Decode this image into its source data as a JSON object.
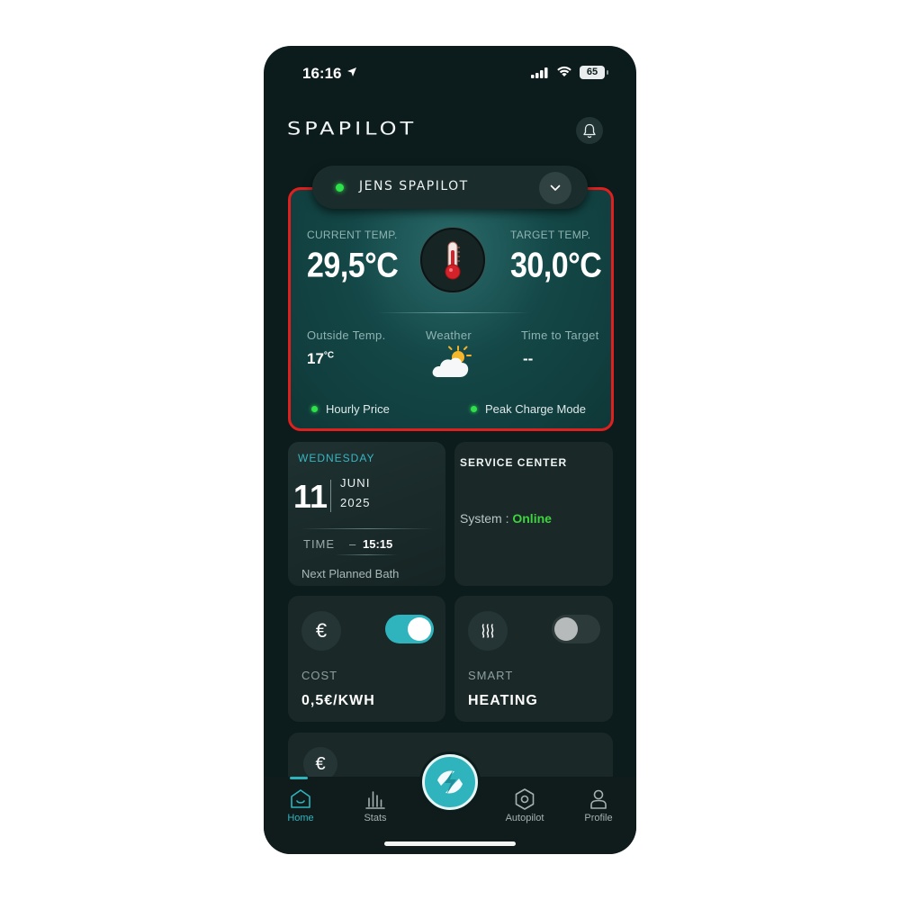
{
  "status_bar": {
    "time": "16:16",
    "battery": "65"
  },
  "header": {
    "brand": "SPAPILOT"
  },
  "device": {
    "name": "JENS SPAPILOT"
  },
  "temperature": {
    "current_label": "CURRENT TEMP.",
    "current_value": "29,5°C",
    "target_label": "TARGET TEMP.",
    "target_value": "30,0°C",
    "outside_label": "Outside Temp.",
    "outside_value": "17",
    "outside_unit": "°C",
    "weather_label": "Weather",
    "time_label": "Time to Target",
    "time_value": "--",
    "hourly_price": "Hourly Price",
    "peak_mode": "Peak Charge Mode"
  },
  "schedule": {
    "weekday": "WEDNESDAY",
    "day": "11",
    "month": "JUNI",
    "year": "2025",
    "time_label": "TIME",
    "time_value": "15:15",
    "next_label": "Next Planned Bath"
  },
  "service": {
    "title": "SERVICE CENTER",
    "system_label": "System : ",
    "system_status": "Online"
  },
  "cost": {
    "icon": "€",
    "label": "COST",
    "value": "0,5€/KWH",
    "toggle_on": true
  },
  "smart": {
    "label": "SMART",
    "value": "HEATING",
    "toggle_on": false
  },
  "partial": {
    "icon": "€"
  },
  "nav": {
    "home": "Home",
    "stats": "Stats",
    "autopilot": "Autopilot",
    "profile": "Profile"
  },
  "colors": {
    "accent": "#2fb4be",
    "online": "#3fd43f",
    "alert_border": "#e01f1f",
    "background": "#0c1c1c"
  }
}
